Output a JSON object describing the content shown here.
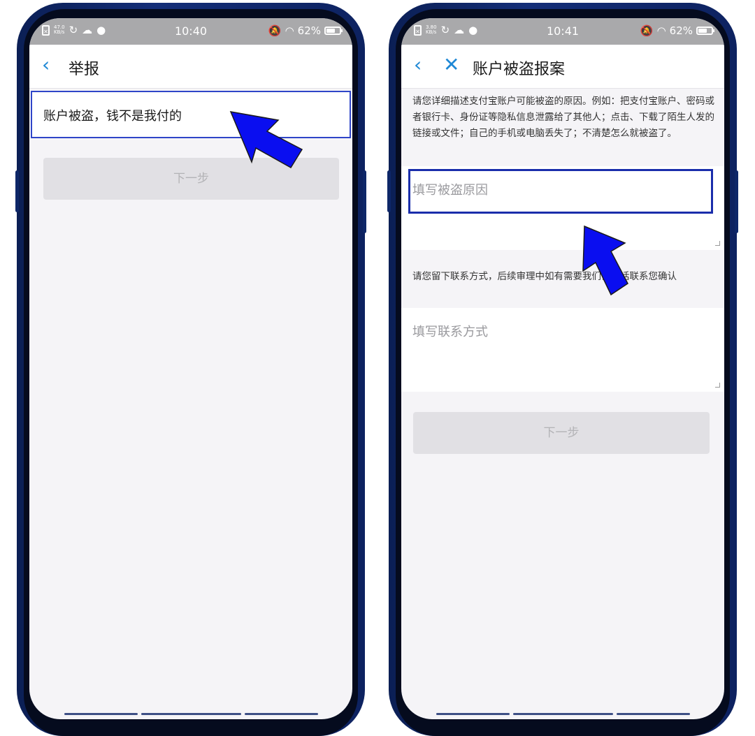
{
  "colors": {
    "accent": "#1e88d5",
    "highlight_outline": "#2f45c8",
    "annotation_arrow": "#0a0ef0",
    "status_bar": "#a9a9ab",
    "disabled_button": "#e1e0e4"
  },
  "left_screen": {
    "status": {
      "speed_value": "47.0",
      "speed_unit": "KB/s",
      "time": "10:40",
      "battery": "62%",
      "battery_level": 0.62,
      "icons": [
        "sim-icon",
        "sync-icon",
        "cloud-icon",
        "wechat-icon",
        "mute-icon",
        "wifi-icon",
        "battery-icon"
      ]
    },
    "nav": {
      "back_icon": "‹",
      "title": "举报"
    },
    "selected_item": "账户被盗，钱不是我付的",
    "next_button": "下一步"
  },
  "right_screen": {
    "status": {
      "speed_value": "3.80",
      "speed_unit": "KB/s",
      "time": "10:41",
      "battery": "62%",
      "battery_level": 0.62,
      "icons": [
        "sim-icon",
        "sync-icon",
        "cloud-icon",
        "wechat-icon",
        "mute-icon",
        "wifi-icon",
        "battery-icon"
      ]
    },
    "nav": {
      "back_icon": "‹",
      "close_icon": "✕",
      "title": "账户被盗报案"
    },
    "reason_description": "请您详细描述支付宝账户可能被盗的原因。例如：把支付宝账户、密码或者银行卡、身份证等隐私信息泄露给了其他人；点击、下载了陌生人发的链接或文件；自己的手机或电脑丢失了；不清楚怎么就被盗了。",
    "reason_placeholder": "填写被盗原因",
    "contact_description": "请您留下联系方式，后续审理中如有需要我们会电话联系您确认",
    "contact_placeholder": "填写联系方式",
    "next_button": "下一步"
  }
}
